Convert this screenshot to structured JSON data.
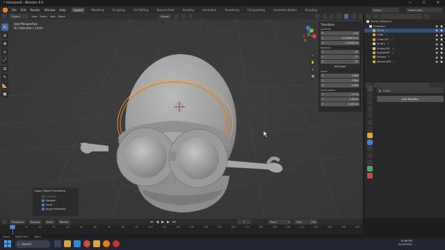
{
  "window": {
    "title": "* (Unsaved) - Blender 4.0",
    "controls": {
      "minimize": "—",
      "maximize": "☐",
      "close": "✕"
    }
  },
  "menu": {
    "items": [
      "File",
      "Edit",
      "Render",
      "Window",
      "Help"
    ],
    "workspaces": [
      "Layout",
      "Modeling",
      "Sculpting",
      "UV Editing",
      "Texture Paint",
      "Shading",
      "Animation",
      "Rendering",
      "Compositing",
      "Geometry Nodes",
      "Scripting"
    ],
    "active_workspace": "Layout",
    "scene_label": "Scene",
    "view_layer_label": "View Layer"
  },
  "viewport_header": {
    "mode": "Object Mode",
    "menus": [
      "View",
      "Select",
      "Add",
      "Object"
    ],
    "orientation": "Global",
    "options_label": "Options"
  },
  "viewport": {
    "view_name": "User Perspective",
    "collection_info": "(1) Collection | Circle"
  },
  "npanel": {
    "title": "Transform",
    "location_label": "Location",
    "location": [
      {
        "axis": "X",
        "value": "0 m"
      },
      {
        "axis": "Y",
        "value": "-0.0029943 m"
      },
      {
        "axis": "Z",
        "value": "1.67285 m"
      }
    ],
    "rotation_label": "Rotation",
    "rotation": [
      {
        "axis": "X",
        "value": "0°"
      },
      {
        "axis": "Y",
        "value": "0°"
      },
      {
        "axis": "Z",
        "value": "0°"
      }
    ],
    "rotation_mode": "XYZ Euler",
    "scale_label": "Scale",
    "scale": [
      {
        "axis": "X",
        "value": "1.000"
      },
      {
        "axis": "Y",
        "value": "1.000"
      },
      {
        "axis": "Z",
        "value": "1.000"
      }
    ],
    "dimensions_label": "Dimensions",
    "dimensions": [
      {
        "axis": "X",
        "value": "1.3 m"
      },
      {
        "axis": "Y",
        "value": "1.36 m"
      },
      {
        "axis": "Z",
        "value": "0.133 m"
      }
    ]
  },
  "operator_panel": {
    "title": "Apply Object Transform",
    "options": [
      {
        "label": "Location",
        "checked": false,
        "enabled": false
      },
      {
        "label": "Rotation",
        "checked": true,
        "enabled": true
      },
      {
        "label": "Scale",
        "checked": true,
        "enabled": true
      },
      {
        "label": "Apply Properties",
        "checked": true,
        "enabled": true
      }
    ]
  },
  "outliner": {
    "root": "Scene Collection",
    "collection": "Collection",
    "items": [
      {
        "name": "Circle",
        "color": "#e0a53c",
        "selected": true
      },
      {
        "name": "Cube",
        "color": "#e0a53c",
        "selected": false
      },
      {
        "name": "Cube.001",
        "color": "#e0a53c",
        "selected": false
      },
      {
        "name": "Empty",
        "color": "#cfcfcf",
        "selected": false
      },
      {
        "name": "Empty.001",
        "color": "#cfcfcf",
        "selected": false
      },
      {
        "name": "NurbsPath",
        "color": "#e0a53c",
        "selected": false
      },
      {
        "name": "Sphere",
        "color": "#e0a53c",
        "selected": false
      },
      {
        "name": "Sphere.001",
        "color": "#e0a53c",
        "selected": false
      }
    ]
  },
  "properties": {
    "object_name": "Circle",
    "add_modifier_label": "Add Modifier"
  },
  "timeline": {
    "menus": [
      "Playback",
      "Keying",
      "View",
      "Marker"
    ],
    "current_frame": "1",
    "start_label": "Start",
    "start": "1",
    "end_label": "End",
    "end": "250",
    "ticks": [
      "0",
      "10",
      "20",
      "30",
      "40",
      "50",
      "60",
      "70",
      "80",
      "90",
      "100",
      "110",
      "120",
      "130",
      "140",
      "150",
      "160",
      "170",
      "180",
      "190",
      "200",
      "210",
      "220",
      "230",
      "240",
      "250"
    ]
  },
  "statusbar": {
    "items": [
      "Select",
      "Rotate View",
      "Object"
    ]
  },
  "taskbar": {
    "search_placeholder": "Search",
    "time": "10:48 PM",
    "date": "12/15/2023"
  },
  "colors": {
    "selection_orange": "#e87d0d",
    "active_blue": "#4a7cc7",
    "gizmo_x": "#e0455b",
    "gizmo_y": "#7bbf2d",
    "gizmo_z": "#3f7de8"
  }
}
